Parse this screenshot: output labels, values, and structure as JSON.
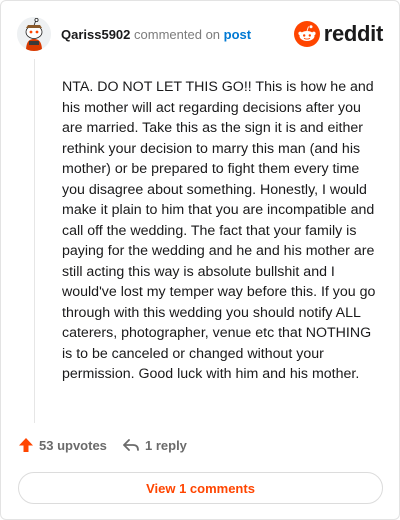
{
  "comment": {
    "author": "Qariss5902",
    "action_text": "commented on",
    "target_link": "post",
    "body": "NTA. DO NOT LET THIS GO!! This is how he and his mother will act regarding decisions after you are married. Take this as the sign it is and either rethink your decision to marry this man (and his mother) or be prepared to fight them every time you disagree about something. Honestly, I would make it plain to him that you are incompatible and call off the wedding. The fact that your family is paying for the wedding and he and his mother are still acting this way is absolute bullshit and I would've lost my temper way before this. If you go through with this wedding you should notify ALL caterers, photographer, venue etc that NOTHING is to be canceled or changed without your permission. Good luck with him and his mother."
  },
  "brand": {
    "wordmark": "reddit",
    "icon": "reddit-logo-icon",
    "color": "#ff4500"
  },
  "avatar": {
    "icon": "snoo-avatar-icon"
  },
  "actions": {
    "upvotes_label": "53 upvotes",
    "upvote_icon": "upvote-arrow-icon",
    "reply_label": "1 reply",
    "reply_icon": "reply-arrow-icon"
  },
  "view_comments_label": "View 1 comments",
  "colors": {
    "accent": "#ff4500",
    "link": "#0079d3",
    "muted": "#7c7c7c"
  }
}
